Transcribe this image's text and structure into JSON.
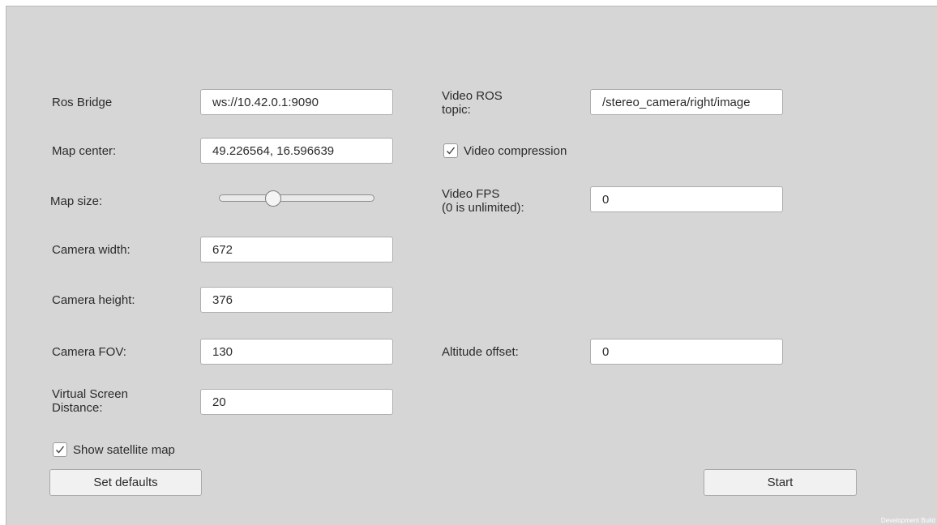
{
  "form": {
    "ros_bridge": {
      "label": "Ros Bridge",
      "value": "ws://10.42.0.1:9090"
    },
    "map_center": {
      "label": "Map center:",
      "value": "49.226564, 16.596639"
    },
    "map_size": {
      "label": "Map size:",
      "slider_fraction": 0.33
    },
    "camera_width": {
      "label": "Camera width:",
      "value": "672"
    },
    "camera_height": {
      "label": "Camera height:",
      "value": "376"
    },
    "camera_fov": {
      "label": "Camera FOV:",
      "value": "130"
    },
    "virtual_screen_distance": {
      "label_line1": "Virtual Screen",
      "label_line2": "Distance:",
      "value": "20"
    },
    "video_ros_topic": {
      "label_line1": "Video ROS",
      "label_line2": "topic:",
      "value": "/stereo_camera/right/image"
    },
    "video_compression": {
      "label": "Video compression",
      "checked": true
    },
    "video_fps": {
      "label_line1": "Video FPS",
      "label_line2": "(0 is unlimited):",
      "value": "0"
    },
    "altitude_offset": {
      "label": "Altitude offset:",
      "value": "0"
    },
    "show_satellite_map": {
      "label": "Show satellite map",
      "checked": true
    }
  },
  "buttons": {
    "set_defaults": "Set defaults",
    "start": "Start"
  },
  "watermark": "Development Build",
  "colors": {
    "background": "#d6d6d6",
    "input_bg": "#ffffff",
    "button_bg": "#f1f1f1",
    "text": "#2b2b2b"
  }
}
